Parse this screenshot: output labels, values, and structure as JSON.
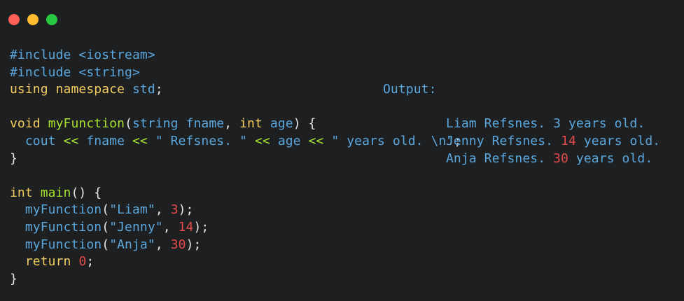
{
  "window": {
    "controls": [
      "close",
      "minimize",
      "maximize"
    ]
  },
  "colors": {
    "background": "#1e1f21",
    "keyword_blue": "#5aa7dd",
    "keyword_yellow": "#f2cc60",
    "function_green": "#a6e22e",
    "number_red": "#e24b4b",
    "punctuation": "#e6e6e6"
  },
  "code": {
    "lines": [
      [
        {
          "t": "#include <iostream>",
          "c": "blue"
        }
      ],
      [
        {
          "t": "#include <string>",
          "c": "blue"
        }
      ],
      [
        {
          "t": "using ",
          "c": "yellow"
        },
        {
          "t": "namespace ",
          "c": "yellow"
        },
        {
          "t": "std",
          "c": "blue"
        },
        {
          "t": ";",
          "c": "white"
        }
      ],
      [],
      [
        {
          "t": "void ",
          "c": "yellow"
        },
        {
          "t": "myFunction",
          "c": "green"
        },
        {
          "t": "(",
          "c": "white"
        },
        {
          "t": "string ",
          "c": "blue"
        },
        {
          "t": "fname",
          "c": "blue"
        },
        {
          "t": ", ",
          "c": "white"
        },
        {
          "t": "int ",
          "c": "yellow"
        },
        {
          "t": "age",
          "c": "blue"
        },
        {
          "t": ") {",
          "c": "white"
        }
      ],
      [
        {
          "t": "  cout ",
          "c": "blue"
        },
        {
          "t": "<< ",
          "c": "green"
        },
        {
          "t": "fname ",
          "c": "blue"
        },
        {
          "t": "<< ",
          "c": "green"
        },
        {
          "t": "\" Refsnes. \" ",
          "c": "blue"
        },
        {
          "t": "<< ",
          "c": "green"
        },
        {
          "t": "age ",
          "c": "blue"
        },
        {
          "t": "<< ",
          "c": "green"
        },
        {
          "t": "\" years old. \\n\"",
          "c": "blue"
        },
        {
          "t": ";",
          "c": "white"
        }
      ],
      [
        {
          "t": "}",
          "c": "white"
        }
      ],
      [],
      [
        {
          "t": "int ",
          "c": "yellow"
        },
        {
          "t": "main",
          "c": "green"
        },
        {
          "t": "() {",
          "c": "white"
        }
      ],
      [
        {
          "t": "  myFunction",
          "c": "blue"
        },
        {
          "t": "(",
          "c": "white"
        },
        {
          "t": "\"Liam\"",
          "c": "blue"
        },
        {
          "t": ", ",
          "c": "white"
        },
        {
          "t": "3",
          "c": "red"
        },
        {
          "t": ");",
          "c": "white"
        }
      ],
      [
        {
          "t": "  myFunction",
          "c": "blue"
        },
        {
          "t": "(",
          "c": "white"
        },
        {
          "t": "\"Jenny\"",
          "c": "blue"
        },
        {
          "t": ", ",
          "c": "white"
        },
        {
          "t": "14",
          "c": "red"
        },
        {
          "t": ");",
          "c": "white"
        }
      ],
      [
        {
          "t": "  myFunction",
          "c": "blue"
        },
        {
          "t": "(",
          "c": "white"
        },
        {
          "t": "\"Anja\"",
          "c": "blue"
        },
        {
          "t": ", ",
          "c": "white"
        },
        {
          "t": "30",
          "c": "red"
        },
        {
          "t": ");",
          "c": "white"
        }
      ],
      [
        {
          "t": "  return ",
          "c": "yellow"
        },
        {
          "t": "0",
          "c": "red"
        },
        {
          "t": ";",
          "c": "white"
        }
      ],
      [
        {
          "t": "}",
          "c": "white"
        }
      ]
    ]
  },
  "output": {
    "label": "Output:",
    "lines": [
      [
        {
          "t": "Liam Refsnes. 3 years old.",
          "c": "blue"
        }
      ],
      [
        {
          "t": "Jenny Refsnes. ",
          "c": "blue"
        },
        {
          "t": "14",
          "c": "red"
        },
        {
          "t": " years old.",
          "c": "blue"
        }
      ],
      [
        {
          "t": "Anja Refsnes. ",
          "c": "blue"
        },
        {
          "t": "30",
          "c": "red"
        },
        {
          "t": " years old.",
          "c": "blue"
        }
      ]
    ]
  }
}
